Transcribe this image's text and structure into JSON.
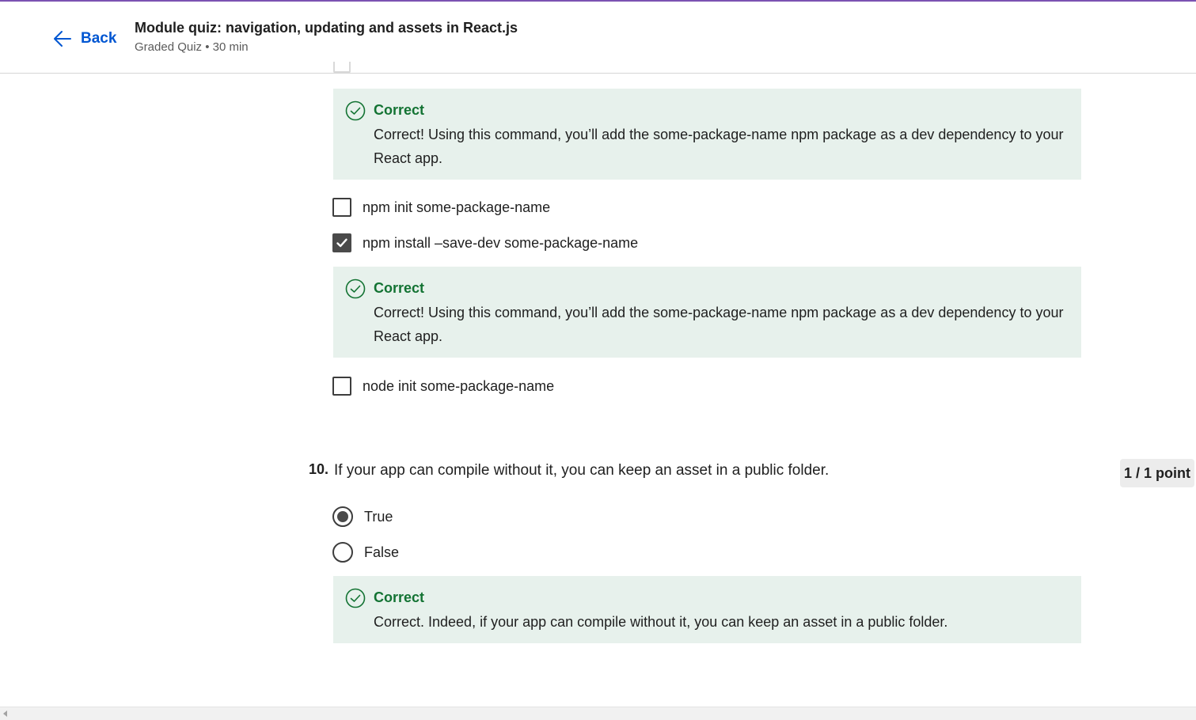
{
  "header": {
    "back_label": "Back",
    "title": "Module quiz: navigation, updating and assets in React.js",
    "subtitle": "Graded Quiz • 30 min"
  },
  "question9": {
    "feedback_top": {
      "status": "Correct",
      "text": "Correct! Using this command, you’ll add the some-package-name npm package as a dev dependency to your React app."
    },
    "options": [
      {
        "label": "npm init some-package-name",
        "checked": false
      },
      {
        "label": "npm install –save-dev some-package-name",
        "checked": true
      },
      {
        "label": "node init some-package-name",
        "checked": false
      }
    ],
    "feedback_mid": {
      "status": "Correct",
      "text": "Correct! Using this command, you’ll add the some-package-name npm package as a dev dependency to your React app."
    }
  },
  "question10": {
    "number": "10.",
    "text": "If your app can compile without it, you can keep an asset in a public folder.",
    "points": "1 / 1 point",
    "options": [
      {
        "label": "True",
        "selected": true
      },
      {
        "label": "False",
        "selected": false
      }
    ],
    "feedback": {
      "status": "Correct",
      "text": "Correct. Indeed, if your app can compile without it, you can keep an asset in a public folder."
    }
  },
  "colors": {
    "accent": "#0056d2",
    "correct": "#137333",
    "feedback_bg": "#e7f1ec",
    "top_line": "#7b52b2"
  },
  "icons": {
    "back": "arrow-left-icon",
    "correct": "check-circle-icon",
    "checked": "checkmark-icon"
  }
}
